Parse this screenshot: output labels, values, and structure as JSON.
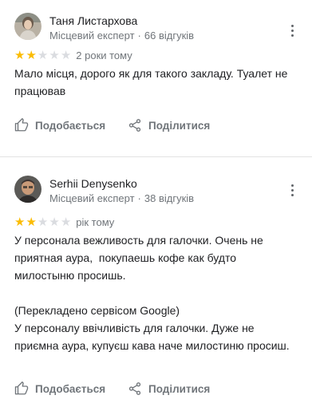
{
  "reviews": [
    {
      "author": "Таня Листархова",
      "badge": "Місцевий експерт",
      "separator": "·",
      "review_count": "66 відгуків",
      "stars": 2,
      "max_stars": 5,
      "time": "2 роки тому",
      "text": "Мало місця, дорого як для такого закладу. Туалет не працював",
      "like_label": "Подобається",
      "share_label": "Поділитися"
    },
    {
      "author": "Serhii Denysenko",
      "badge": "Місцевий експерт",
      "separator": "·",
      "review_count": "38 відгуків",
      "stars": 2,
      "max_stars": 5,
      "time": "рік тому",
      "text": "У персонала вежливость для галочки. Очень не приятная аура,  покупаешь кофе как будто милостыню просишь.\n\n(Перекладено сервісом Google)\nУ персоналу ввічливість для галочки. Дуже не приємна аура, купуєш кава наче милостиню просиш.",
      "like_label": "Подобається",
      "share_label": "Поділитися"
    }
  ],
  "colors": {
    "star_on": "#fbbc04",
    "star_off": "#dadce0",
    "secondary_text": "#70757a",
    "primary_text": "#202124"
  },
  "icons": {
    "more": "more-vert-icon",
    "like": "thumb-up-icon",
    "share": "share-icon"
  }
}
